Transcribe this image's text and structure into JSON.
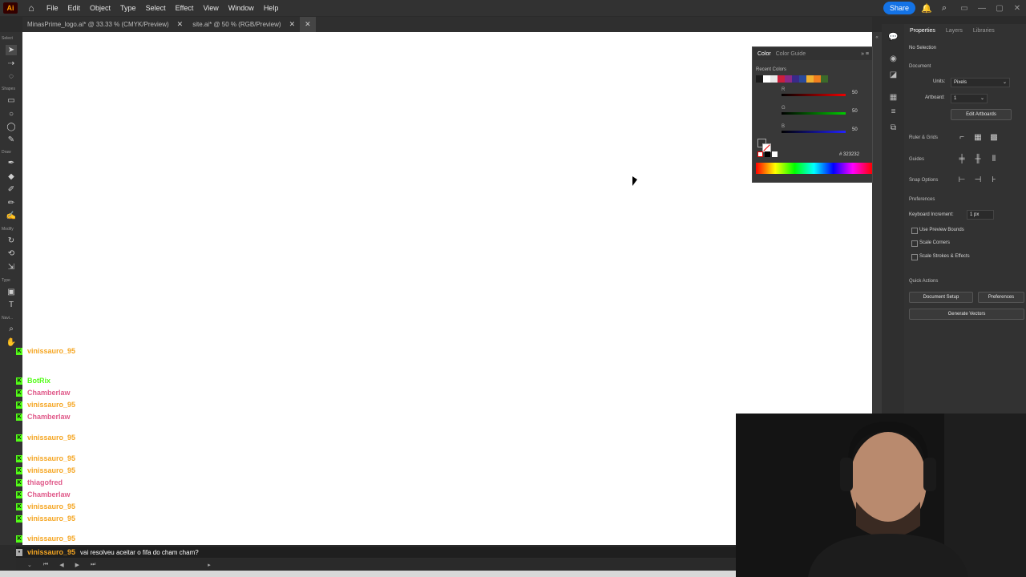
{
  "app": {
    "logo": "Ai",
    "home_icon": "home-icon"
  },
  "menu": [
    "File",
    "Edit",
    "Object",
    "Type",
    "Select",
    "Effect",
    "View",
    "Window",
    "Help"
  ],
  "topright": {
    "share_label": "Share",
    "icons": [
      "bell-icon",
      "search-icon"
    ]
  },
  "tabs": [
    {
      "label": "MinasPrime_logo.ai* @ 33.33 % (CMYK/Preview)",
      "active": false
    },
    {
      "label": "site.ai* @ 50 % (RGB/Preview)",
      "active": true
    }
  ],
  "toolbar_labels": {
    "select": "Select",
    "shapes": "Shapes",
    "draw": "Draw",
    "modify": "Modify",
    "type": "Type",
    "navigate": "Navi..."
  },
  "color_panel": {
    "tabs": [
      "Color",
      "Color Guide"
    ],
    "recent_label": "Recent Colors",
    "recent_colors": [
      "#1a1a1a",
      "#ffffff",
      "#e6e6e6",
      "#cc1e3c",
      "#8b2a86",
      "#3a2a8a",
      "#2a4a9a",
      "#f0b030",
      "#f07f1e",
      "#3c6a2a"
    ],
    "channels": [
      {
        "name": "R",
        "value": "50"
      },
      {
        "name": "G",
        "value": "50"
      },
      {
        "name": "B",
        "value": "50"
      }
    ],
    "hex_label": "#",
    "hex_value": "323232"
  },
  "properties": {
    "tabs": [
      "Properties",
      "Layers",
      "Libraries"
    ],
    "no_selection": "No Selection",
    "document": "Document",
    "units_label": "Units:",
    "units_value": "Pixels",
    "artboard_label": "Artboard:",
    "artboard_value": "1",
    "edit_artboards": "Edit Artboards",
    "rulers_grids": "Ruler & Grids",
    "guides": "Guides",
    "snap_options": "Snap Options",
    "preferences": "Preferences",
    "keyboard_increment_label": "Keyboard Increment:",
    "keyboard_increment_value": "1 px",
    "use_preview_bounds": "Use Preview Bounds",
    "scale_corners": "Scale Corners",
    "scale_strokes": "Scale Strokes & Effects",
    "quick_actions": "Quick Actions",
    "document_setup": "Document Setup",
    "preferences_btn": "Preferences",
    "generate_vectors": "Generate Vectors"
  },
  "chat": {
    "messages": [
      {
        "user": "vinissauro_95",
        "color": "#f5a623",
        "text": ""
      },
      {
        "user": "BotRix",
        "color": "#53fc18",
        "text": ""
      },
      {
        "user": "Chamberlaw",
        "color": "#e05a8a",
        "text": ""
      },
      {
        "user": "vinissauro_95",
        "color": "#f5a623",
        "text": ""
      },
      {
        "user": "Chamberlaw",
        "color": "#e05a8a",
        "text": ""
      },
      {
        "user": "vinissauro_95",
        "color": "#f5a623",
        "text": ""
      },
      {
        "user": "vinissauro_95",
        "color": "#f5a623",
        "text": ""
      },
      {
        "user": "vinissauro_95",
        "color": "#f5a623",
        "text": ""
      },
      {
        "user": "thiagofred",
        "color": "#e05a8a",
        "text": ""
      },
      {
        "user": "Chamberlaw",
        "color": "#e05a8a",
        "text": ""
      },
      {
        "user": "vinissauro_95",
        "color": "#f5a623",
        "text": ""
      },
      {
        "user": "vinissauro_95",
        "color": "#f5a623",
        "text": ""
      },
      {
        "user": "vinissauro_95",
        "color": "#f5a623",
        "text": ""
      }
    ],
    "last": {
      "user": "vinissauro_95",
      "text": "vai resolveu aceitar o fifa do cham cham?"
    }
  }
}
